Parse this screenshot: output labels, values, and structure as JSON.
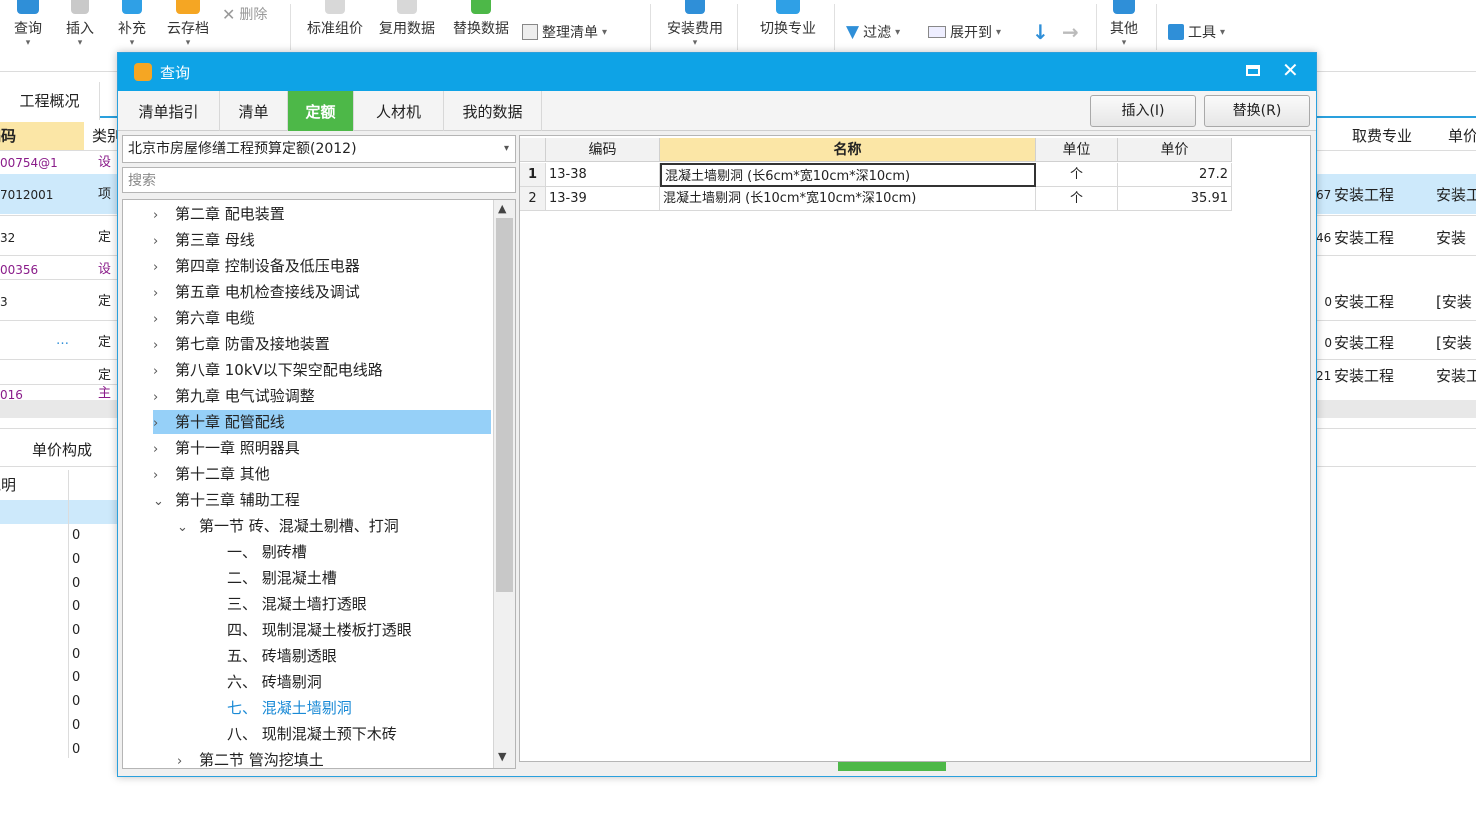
{
  "ribbon": {
    "query": "查询",
    "insert": "插入",
    "supplement": "补充",
    "cloud_archive": "云存档",
    "delete": "删除",
    "standard_group_price": "标准组价",
    "reuse_data": "复用数据",
    "replace_data": "替换数据",
    "organize_list": "整理清单",
    "install_fee": "安装费用",
    "switch_major": "切换专业",
    "filter": "过滤",
    "expand_to": "展开到",
    "other": "其他",
    "tools": "工具"
  },
  "background": {
    "overview_tab": "工程概况",
    "col_code": "编码",
    "col_type": "类别",
    "col_fee_major": "取费专业",
    "col_unit_price": "单价",
    "left_codes": [
      "00754@1",
      "7012001",
      "32",
      "00356",
      "3",
      "…",
      "",
      "016"
    ],
    "left_types": [
      "设",
      "项",
      "定",
      "设",
      "定",
      "定",
      "定",
      "主"
    ],
    "right_nums": [
      "",
      "67",
      "46",
      "",
      "0",
      "0",
      "21"
    ],
    "right_major": [
      "",
      "安装工程",
      "安装工程",
      "",
      "安装工程",
      "安装工程",
      "安装工程"
    ],
    "right_unit": [
      "",
      "安装工",
      "安装",
      "",
      "[安装",
      "[安装",
      "安装工"
    ],
    "bottom_tab": "单价构成",
    "bottom_col": "说明",
    "bottom_zeros": [
      "0",
      "0",
      "0",
      "0",
      "0",
      "0",
      "0",
      "0",
      "0",
      "0"
    ]
  },
  "dialog": {
    "title": "查询",
    "tabs": [
      "清单指引",
      "清单",
      "定额",
      "人材机",
      "我的数据"
    ],
    "active_tab": "定额",
    "insert_button": "插入(I)",
    "replace_button": "替换(R)",
    "quota_library": "北京市房屋修缮工程预算定额(2012)",
    "search_placeholder": "搜索",
    "tree": [
      {
        "label": "第二章  配电装置",
        "level": 0,
        "arrow": "›"
      },
      {
        "label": "第三章  母线",
        "level": 0,
        "arrow": "›"
      },
      {
        "label": "第四章  控制设备及低压电器",
        "level": 0,
        "arrow": "›"
      },
      {
        "label": "第五章  电机检查接线及调试",
        "level": 0,
        "arrow": "›"
      },
      {
        "label": "第六章  电缆",
        "level": 0,
        "arrow": "›"
      },
      {
        "label": "第七章  防雷及接地装置",
        "level": 0,
        "arrow": "›"
      },
      {
        "label": "第八章  10kV以下架空配电线路",
        "level": 0,
        "arrow": "›"
      },
      {
        "label": "第九章  电气试验调整",
        "level": 0,
        "arrow": "›"
      },
      {
        "label": "第十章  配管配线",
        "level": 0,
        "arrow": "›"
      },
      {
        "label": "第十一章  照明器具",
        "level": 0,
        "arrow": "›"
      },
      {
        "label": "第十二章  其他",
        "level": 0,
        "arrow": "›"
      },
      {
        "label": "第十三章  辅助工程",
        "level": 0,
        "arrow": "⌄"
      },
      {
        "label": "第一节  砖、混凝土剔槽、打洞",
        "level": 1,
        "arrow": "⌄"
      },
      {
        "label": "一、  剔砖槽",
        "level": 2,
        "arrow": ""
      },
      {
        "label": "二、  剔混凝土槽",
        "level": 2,
        "arrow": ""
      },
      {
        "label": "三、  混凝土墙打透眼",
        "level": 2,
        "arrow": ""
      },
      {
        "label": "四、  现制混凝土楼板打透眼",
        "level": 2,
        "arrow": ""
      },
      {
        "label": "五、  砖墙剔透眼",
        "level": 2,
        "arrow": ""
      },
      {
        "label": "六、  砖墙剔洞",
        "level": 2,
        "arrow": ""
      },
      {
        "label": "七、  混凝土墙剔洞",
        "level": 2,
        "arrow": ""
      },
      {
        "label": "八、  现制混凝土预下木砖",
        "level": 2,
        "arrow": ""
      },
      {
        "label": "第二节  管沟挖填土",
        "level": 1,
        "arrow": "›"
      }
    ],
    "selected_tree_item": "第十章  配管配线",
    "highlighted_tree_item": "七、  混凝土墙剔洞",
    "table": {
      "headers": [
        "编码",
        "名称",
        "单位",
        "单价"
      ],
      "rows": [
        {
          "no": "1",
          "code": "13-38",
          "name": "混凝土墙剔洞 (长6cm*宽10cm*深10cm)",
          "unit": "个",
          "price": "27.2"
        },
        {
          "no": "2",
          "code": "13-39",
          "name": "混凝土墙剔洞 (长10cm*宽10cm*深10cm)",
          "unit": "个",
          "price": "35.91"
        }
      ]
    }
  },
  "colors": {
    "title_bar": "#0ea3e6",
    "active_tab": "#4db848",
    "selection": "#96d0f8",
    "highlight_text": "#1a8ad6"
  }
}
